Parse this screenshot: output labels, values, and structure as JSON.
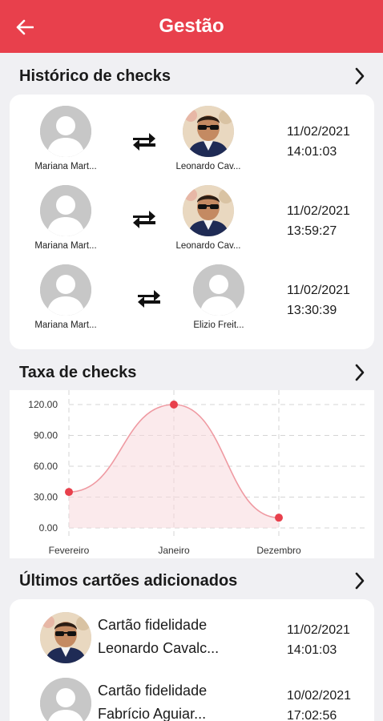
{
  "appbar": {
    "title": "Gestão",
    "back_icon": "arrow-left-icon"
  },
  "historico": {
    "title": "Histórico de checks",
    "rows": [
      {
        "from_name": "Mariana Mart...",
        "to_name": "Leonardo Cav...",
        "to_photo": true,
        "date": "11/02/2021",
        "time": "14:01:03"
      },
      {
        "from_name": "Mariana Mart...",
        "to_name": "Leonardo Cav...",
        "to_photo": true,
        "date": "11/02/2021",
        "time": "13:59:27"
      },
      {
        "from_name": "Mariana Mart...",
        "to_name": "Elizio Freit...",
        "to_photo": false,
        "date": "11/02/2021",
        "time": "13:30:39"
      }
    ]
  },
  "taxa": {
    "title": "Taxa de checks",
    "chart_data": {
      "type": "line",
      "categories": [
        "Fevereiro",
        "Janeiro",
        "Dezembro"
      ],
      "values": [
        35,
        120,
        10
      ],
      "ylim": [
        0,
        120
      ],
      "y_ticks": [
        "120.00",
        "90.00",
        "60.00",
        "30.00",
        "0.00"
      ],
      "grid": true,
      "color": "#e8404c"
    }
  },
  "ultimos": {
    "title": "Últimos cartões adicionados",
    "rows": [
      {
        "line1": "Cartão fidelidade",
        "line2": "Leonardo Cavalc...",
        "photo": true,
        "date": "11/02/2021",
        "time": "14:01:03"
      },
      {
        "line1": "Cartão fidelidade",
        "line2": "Fabrício Aguiar...",
        "photo": false,
        "date": "10/02/2021",
        "time": "17:02:56"
      }
    ]
  }
}
